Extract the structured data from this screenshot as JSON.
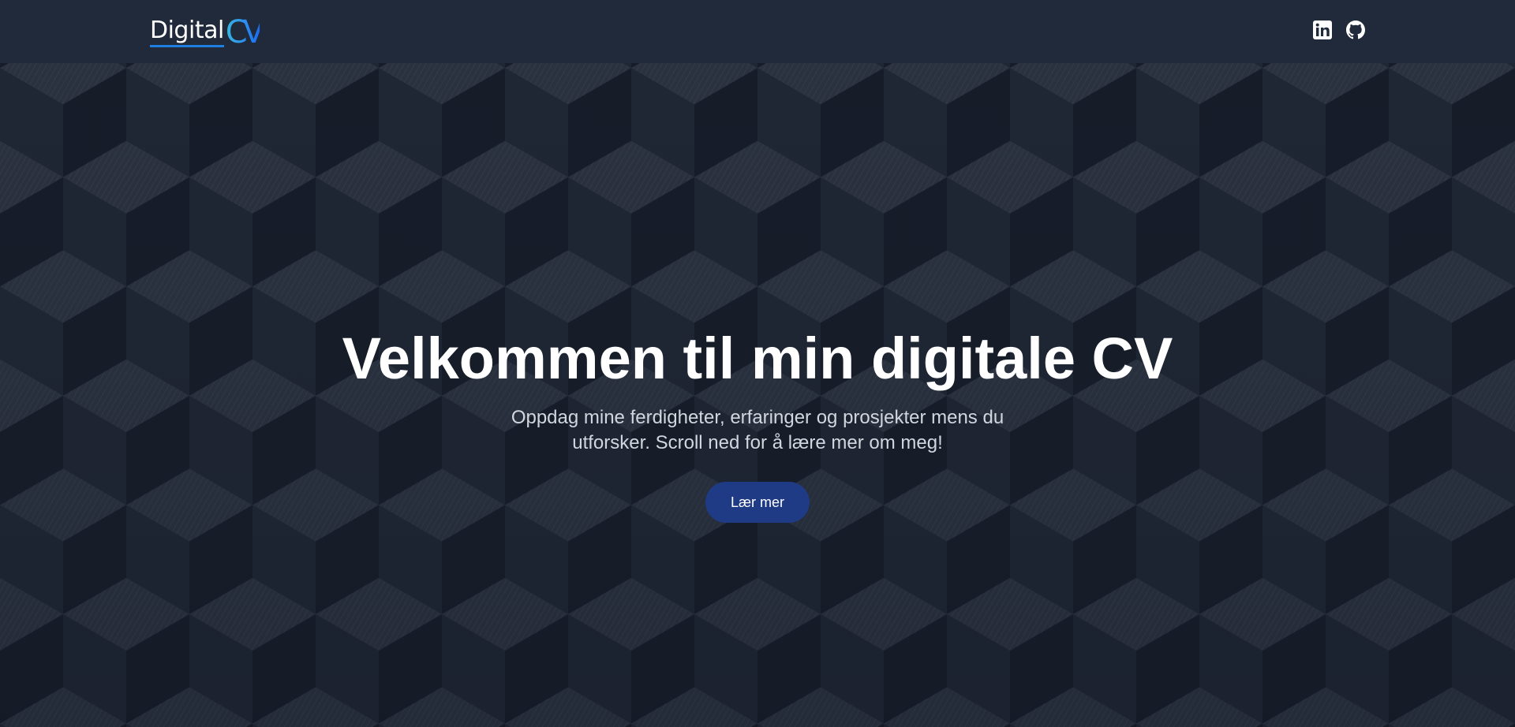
{
  "header": {
    "logo": {
      "word": "Digital",
      "mark": "CV"
    },
    "social": [
      {
        "icon": "linkedin-icon"
      },
      {
        "icon": "github-icon"
      }
    ]
  },
  "hero": {
    "title": "Velkommen til min digitale CV",
    "subtitle": "Oppdag mine ferdigheter, erfaringer og prosjekter mens du utforsker. Scroll ned for å lære mer om meg!",
    "button_label": "Lær mer"
  },
  "colors": {
    "header_bg": "#212a3a",
    "hero_bg": "#1c2331",
    "button_bg": "#203b86",
    "logo_accent": "#2b8cf0"
  }
}
